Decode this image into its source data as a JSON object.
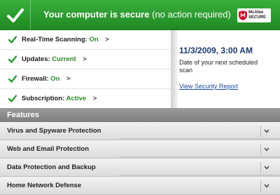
{
  "header": {
    "title": "Your computer is secure",
    "subtitle": "(no action required)",
    "brand": "McAfee",
    "brand_sub": "SECURE",
    "colors": {
      "green": "#2a9b2e",
      "status_value": "#2a8b2b",
      "date": "#1a3a70"
    },
    "icons": {
      "status": "checkmark-icon",
      "brand": "mcafee-shield-icon"
    }
  },
  "status": {
    "items": [
      {
        "label": "Real-Time Scanning:",
        "value": "On",
        "arrow": ">"
      },
      {
        "label": "Updates:",
        "value": "Current",
        "arrow": ">"
      },
      {
        "label": "Firewall:",
        "value": "On",
        "arrow": ">"
      },
      {
        "label": "Subscription:",
        "value": "Active",
        "arrow": ">"
      }
    ]
  },
  "schedule": {
    "date": "11/3/2009, 3:00 AM",
    "description": "Date of your next scheduled scan",
    "link": "View Security Report"
  },
  "features": {
    "title": "Features",
    "items": [
      {
        "label": "Virus and Spyware Protection"
      },
      {
        "label": "Web and Email Protection"
      },
      {
        "label": "Data Protection and Backup"
      },
      {
        "label": "Home Network Defense"
      }
    ]
  }
}
